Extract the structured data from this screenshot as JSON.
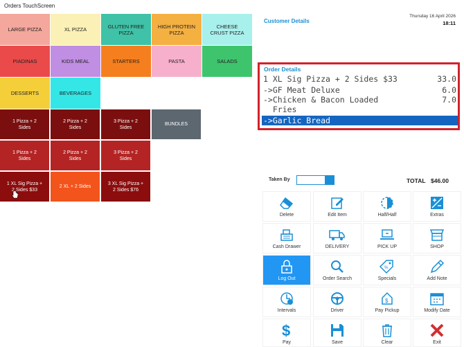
{
  "window": {
    "title": "Orders TouchScreen"
  },
  "categories": [
    {
      "label": "LARGE PIZZA",
      "color": "#f4a79c"
    },
    {
      "label": "XL PIZZA",
      "color": "#fbf0b5"
    },
    {
      "label": "GLUTEN FREE\nPIZZA",
      "color": "#3fc2a7"
    },
    {
      "label": "HIGH PROTEIN\nPIZZA",
      "color": "#f5b042"
    },
    {
      "label": "CHEESE\nCRUST PIZZA",
      "color": "#a8f0ec"
    },
    {
      "label": "PIADINAS",
      "color": "#ea4a4a"
    },
    {
      "label": "KIDS MEAL",
      "color": "#c08ee2"
    },
    {
      "label": "STARTERS",
      "color": "#f57f1f"
    },
    {
      "label": "PASTA",
      "color": "#f7b0cb"
    },
    {
      "label": "SALADS",
      "color": "#3ec46d"
    },
    {
      "label": "DESSERTS",
      "color": "#f5cf3a"
    },
    {
      "label": "BEVERAGES",
      "color": "#35e6e6"
    }
  ],
  "products": [
    {
      "label": "1 Pizza + 2\nSides",
      "color": "#7b0f0f"
    },
    {
      "label": "2 Pizza + 2\nSides",
      "color": "#7b0f0f"
    },
    {
      "label": "3 Pizza + 2\nSides",
      "color": "#7b0f0f"
    },
    {
      "label": "BUNDLES",
      "color": "#5c6770"
    },
    {
      "label": "1 Pizza + 2\nSides",
      "color": "#b42424"
    },
    {
      "label": "2 Pizza + 2\nSides",
      "color": "#b42424"
    },
    {
      "label": "3 Pizza + 2\nSides",
      "color": "#b42424"
    },
    {
      "label": "1 XL Sig Pizza +\n2 Sides $33",
      "color": "#8b0d0d"
    },
    {
      "label": "2 XL + 2 Sides",
      "color": "#f2541b"
    },
    {
      "label": "3 XL Sig Pizza +\n2 Sides $76",
      "color": "#8b0d0d"
    }
  ],
  "customer": {
    "heading": "Customer Details"
  },
  "clock": {
    "date": "Thursday 16 April 2026",
    "time": "18:11"
  },
  "order": {
    "heading": "Order Details",
    "lines": [
      {
        "text": "1 XL Sig Pizza + 2 Sides $33",
        "price": "33.0",
        "selected": false
      },
      {
        "text": "->GF Meat Deluxe",
        "price": "6.0",
        "selected": false
      },
      {
        "text": "->Chicken & Bacon Loaded",
        "price": "7.0",
        "selected": false
      },
      {
        "text": "  Fries",
        "price": "",
        "selected": false
      },
      {
        "text": "->Garlic Bread",
        "price": "",
        "selected": true
      }
    ]
  },
  "taken_by": {
    "label": "Taken By",
    "value": ""
  },
  "total": {
    "label": "TOTAL",
    "value": "$46.00"
  },
  "actions": [
    {
      "label": "Delete",
      "icon": "eraser-icon"
    },
    {
      "label": "Edit Item",
      "icon": "edit-icon"
    },
    {
      "label": "Half/Half",
      "icon": "half-circle-icon"
    },
    {
      "label": "Extras",
      "icon": "plus-minus-icon"
    },
    {
      "label": "Cash Drawer",
      "icon": "cash-register-icon"
    },
    {
      "label": "DELIVERY",
      "icon": "truck-icon"
    },
    {
      "label": "PICK UP",
      "icon": "laptop-icon"
    },
    {
      "label": "SHOP",
      "icon": "shop-icon"
    },
    {
      "label": "Log Out",
      "icon": "lock-icon",
      "active": true
    },
    {
      "label": "Order Search",
      "icon": "magnifier-icon"
    },
    {
      "label": "Specials",
      "icon": "tag-icon"
    },
    {
      "label": "Add Note",
      "icon": "pencil-icon"
    },
    {
      "label": "Intervals",
      "icon": "clock-icon"
    },
    {
      "label": "Driver",
      "icon": "steering-wheel-icon"
    },
    {
      "label": "Pay Pickup",
      "icon": "pay-pickup-icon"
    },
    {
      "label": "Modify Date",
      "icon": "calendar-icon"
    },
    {
      "label": "Pay",
      "icon": "dollar-icon"
    },
    {
      "label": "Save",
      "icon": "floppy-icon"
    },
    {
      "label": "Clear",
      "icon": "trash-icon"
    },
    {
      "label": "Exit",
      "icon": "close-icon"
    }
  ]
}
